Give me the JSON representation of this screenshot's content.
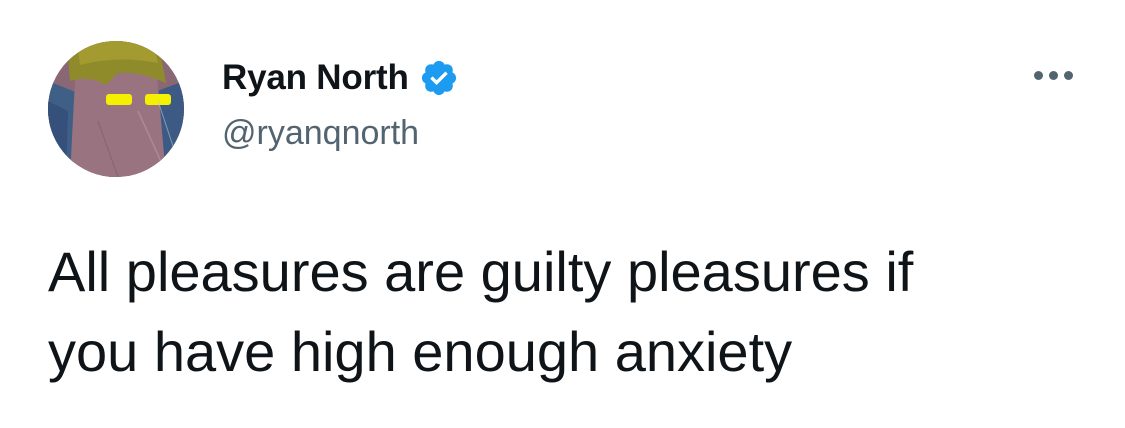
{
  "author": {
    "display_name": "Ryan North",
    "handle": "@ryanqnorth",
    "verified": true,
    "avatar_icon": "cartoon-character-avatar"
  },
  "more_menu": {
    "icon": "ellipsis-icon"
  },
  "tweet": {
    "text": "All pleasures are guilty pleasures if\nyou have high enough anxiety"
  },
  "colors": {
    "verified_blue": "#1d9bf0",
    "name_text": "#0f1419",
    "handle_text": "#536471",
    "background": "#ffffff"
  }
}
